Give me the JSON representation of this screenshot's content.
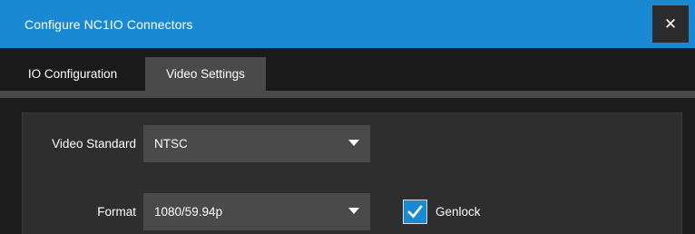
{
  "window": {
    "title": "Configure NC1IO Connectors",
    "close_label": "✕"
  },
  "tabs": [
    {
      "label": "IO Configuration",
      "active": false
    },
    {
      "label": "Video Settings",
      "active": true
    }
  ],
  "video_settings": {
    "video_standard": {
      "label": "Video Standard",
      "value": "NTSC"
    },
    "format": {
      "label": "Format",
      "value": "1080/59.94p"
    },
    "genlock": {
      "label": "Genlock",
      "checked": true
    }
  },
  "colors": {
    "accent": "#1a89d3",
    "titlebar": "#1a89d3",
    "panel": "#2e2e2e",
    "control": "#4a4a4a"
  }
}
